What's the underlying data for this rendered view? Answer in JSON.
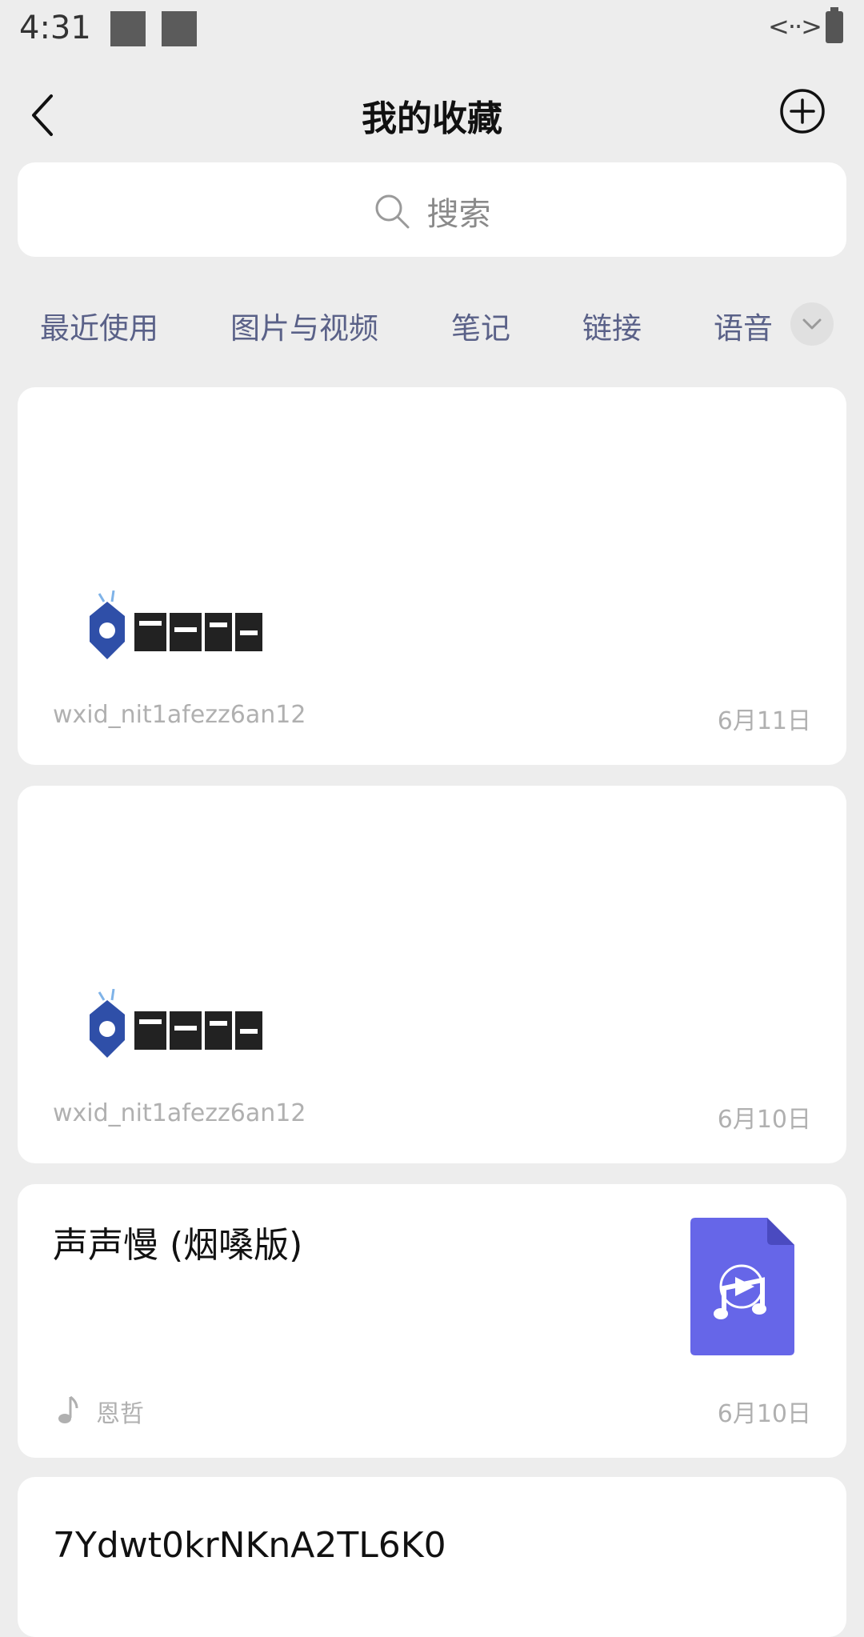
{
  "status": {
    "time": "4:31",
    "network_text": "<··>"
  },
  "header": {
    "title": "我的收藏"
  },
  "search": {
    "placeholder": "搜索"
  },
  "tabs": [
    {
      "label": "最近使用"
    },
    {
      "label": "图片与视频"
    },
    {
      "label": "笔记"
    },
    {
      "label": "链接"
    },
    {
      "label": "语音"
    }
  ],
  "items": [
    {
      "type": "image",
      "logo_text": "终端云测",
      "source": "wxid_nit1afezz6an12",
      "date": "6月11日"
    },
    {
      "type": "image",
      "logo_text": "终端云测",
      "source": "wxid_nit1afezz6an12",
      "date": "6月10日"
    },
    {
      "type": "music",
      "title": "声声慢 (烟嗓版)",
      "artist": "恩哲",
      "date": "6月10日"
    },
    {
      "type": "text",
      "title": "7Ydwt0krNKnA2TL6K0"
    }
  ],
  "colors": {
    "background": "#ededed",
    "card": "#ffffff",
    "tab_text": "#5a6188",
    "music_file": "#6666e8",
    "logo_blue": "#2f4fa8"
  }
}
